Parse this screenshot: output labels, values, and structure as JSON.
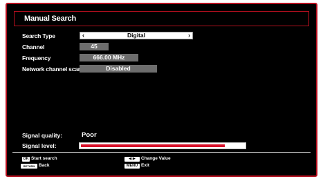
{
  "window": {
    "title": "Manual Search"
  },
  "settings": {
    "search_type": {
      "label": "Search Type",
      "value": "Digital",
      "left_arrow": "‹",
      "right_arrow": "›"
    },
    "channel": {
      "label": "Channel",
      "value": "45"
    },
    "frequency": {
      "label": "Frequency",
      "value": "666.00 MHz"
    },
    "network_scan": {
      "label": "Network channel scan",
      "value": "Disabled"
    }
  },
  "signal": {
    "quality_label": "Signal quality:",
    "quality_value": "Poor",
    "level_label": "Signal level:",
    "level_fraction": 0.88,
    "level_color": "#d8102a"
  },
  "footer": {
    "ok_key": "OK",
    "ok_text": "Start search",
    "return_key": "RETURN",
    "return_text": "Back",
    "lr_key": "◀ ▶",
    "lr_text": "Change Value",
    "menu_key": "MENU",
    "menu_text": "Exit"
  },
  "colors": {
    "accent": "#b40f1e",
    "background": "#000000",
    "value_box": "#6d6d6d"
  }
}
